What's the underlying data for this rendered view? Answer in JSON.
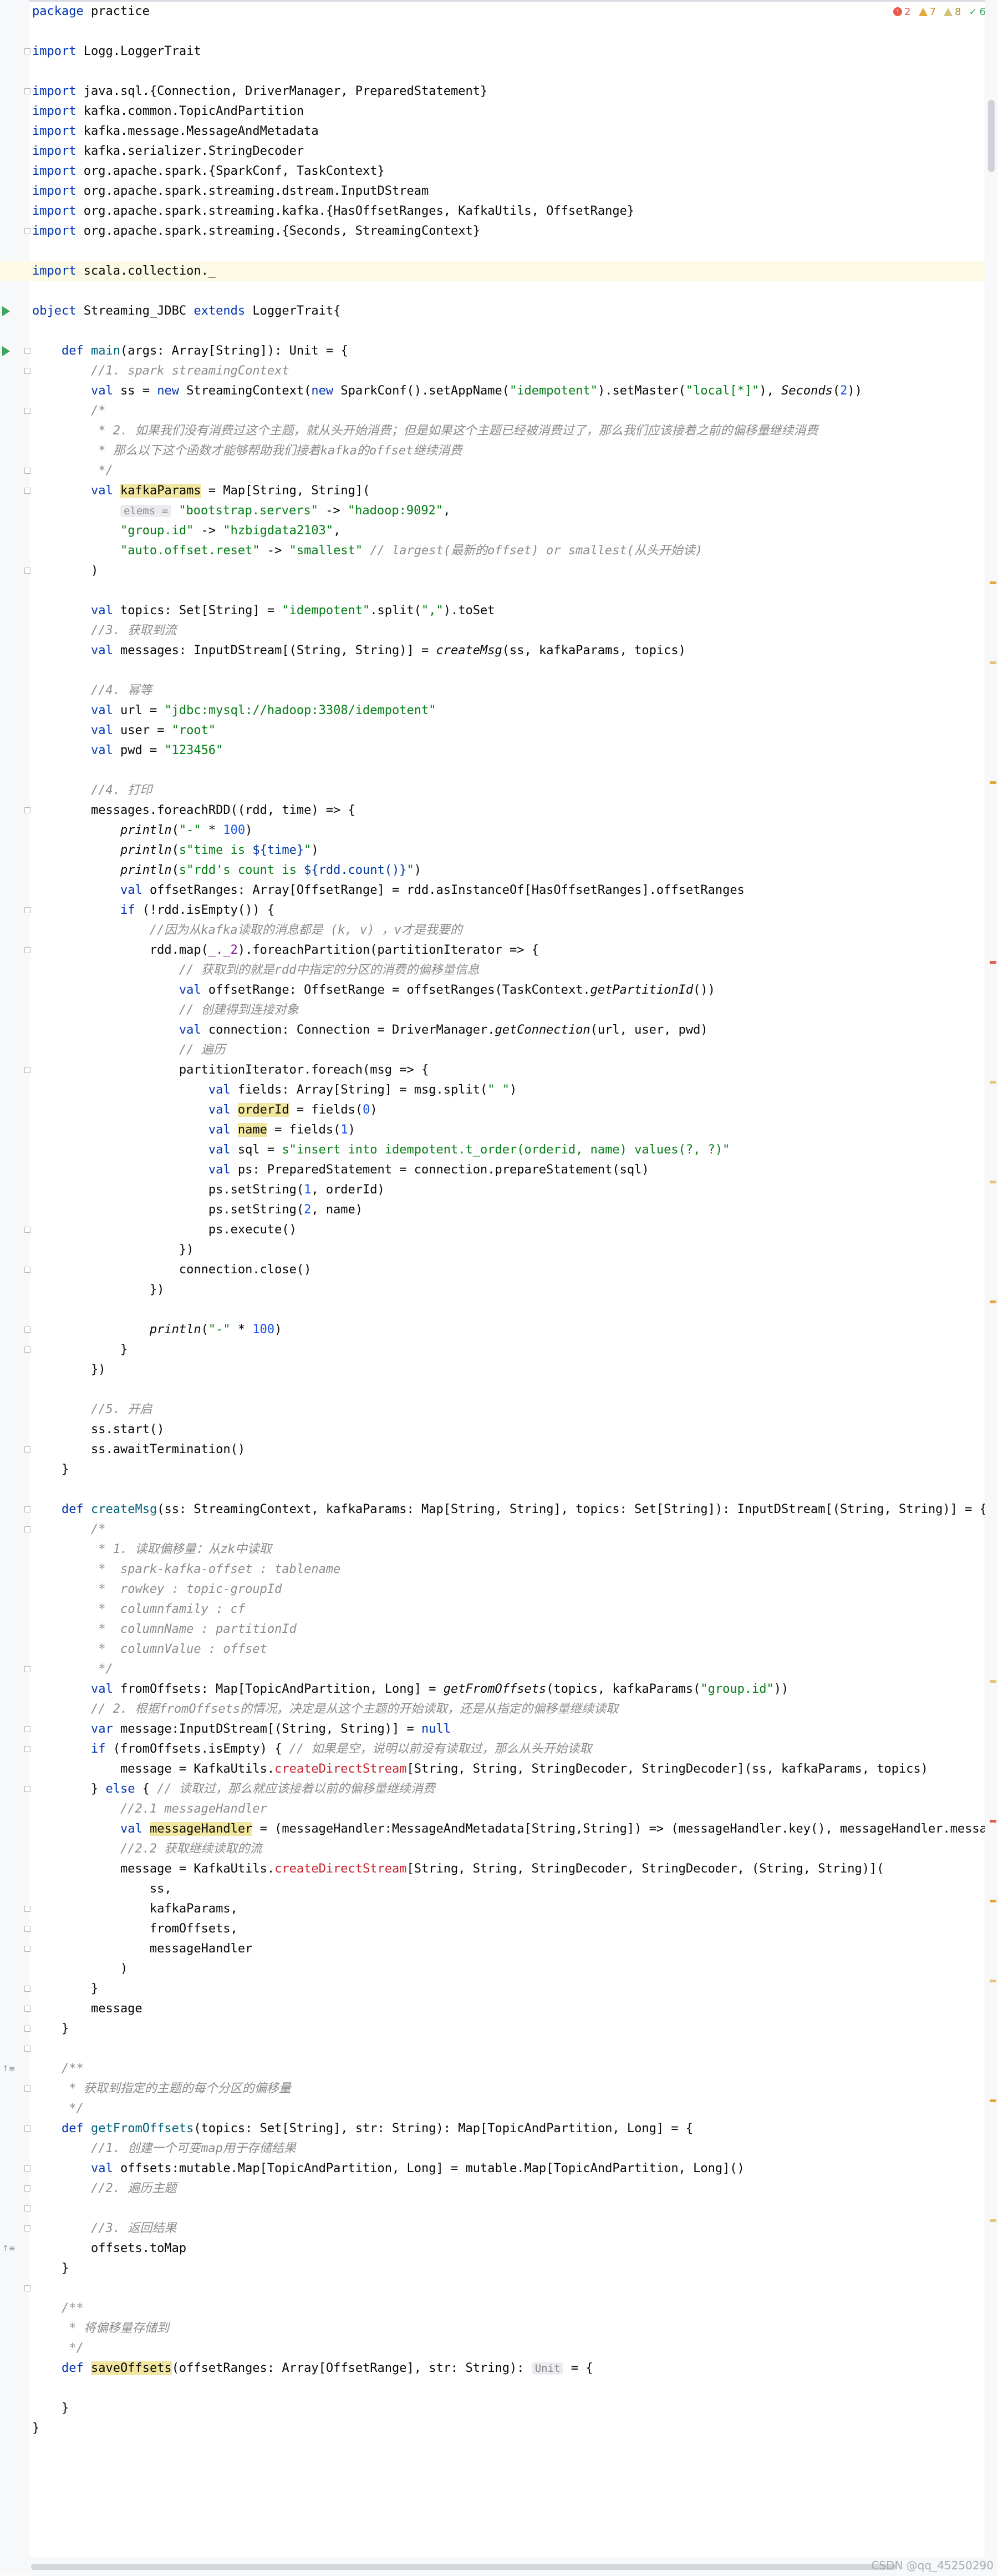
{
  "inspections": {
    "errors": "2",
    "warnings": "7",
    "weak_warnings": "8",
    "typos": "6"
  },
  "code_lines": [
    [
      {
        "t": "package",
        "k": "kw"
      },
      {
        "t": " practice"
      }
    ],
    [],
    [
      {
        "t": "import",
        "k": "kw"
      },
      {
        "t": " Logg.LoggerTrait"
      }
    ],
    [],
    [
      {
        "t": "import",
        "k": "kw"
      },
      {
        "t": " java.sql.{Connection, DriverManager, PreparedStatement}"
      }
    ],
    [
      {
        "t": "import",
        "k": "kw"
      },
      {
        "t": " kafka.common.TopicAndPartition"
      }
    ],
    [
      {
        "t": "import",
        "k": "kw"
      },
      {
        "t": " kafka.message.MessageAndMetadata"
      }
    ],
    [
      {
        "t": "import",
        "k": "kw"
      },
      {
        "t": " kafka.serializer.StringDecoder"
      }
    ],
    [
      {
        "t": "import",
        "k": "kw"
      },
      {
        "t": " org.apache.spark.{SparkConf, TaskContext}"
      }
    ],
    [
      {
        "t": "import",
        "k": "kw"
      },
      {
        "t": " org.apache.spark.streaming.dstream.InputDStream"
      }
    ],
    [
      {
        "t": "import",
        "k": "kw"
      },
      {
        "t": " org.apache.spark.streaming.kafka.{HasOffsetRanges, KafkaUtils, OffsetRange}"
      }
    ],
    [
      {
        "t": "import",
        "k": "kw"
      },
      {
        "t": " org.apache.spark.streaming.{Seconds, StreamingContext}"
      }
    ],
    [],
    [
      {
        "t": "import",
        "k": "kw"
      },
      {
        "t": " scala.collection._"
      }
    ],
    [],
    [
      {
        "t": "object",
        "k": "kw"
      },
      {
        "t": " Streaming_JDBC "
      },
      {
        "t": "extends",
        "k": "kw"
      },
      {
        "t": " LoggerTrait{"
      }
    ],
    [],
    [
      {
        "t": "    "
      },
      {
        "t": "def",
        "k": "kw"
      },
      {
        "t": " "
      },
      {
        "t": "main",
        "k": "f"
      },
      {
        "t": "(args: Array[String]): Unit = {"
      }
    ],
    [
      {
        "t": "        "
      },
      {
        "t": "//1. spark streamingContext",
        "k": "c"
      }
    ],
    [
      {
        "t": "        "
      },
      {
        "t": "val",
        "k": "kw"
      },
      {
        "t": " ss = "
      },
      {
        "t": "new",
        "k": "kw"
      },
      {
        "t": " StreamingContext("
      },
      {
        "t": "new",
        "k": "kw"
      },
      {
        "t": " SparkConf().setAppName("
      },
      {
        "t": "\"idempotent\"",
        "k": "s"
      },
      {
        "t": ").setMaster("
      },
      {
        "t": "\"local[*]\"",
        "k": "s"
      },
      {
        "t": "), "
      },
      {
        "t": "Seconds",
        "k": "it"
      },
      {
        "t": "("
      },
      {
        "t": "2",
        "k": "n"
      },
      {
        "t": "))"
      }
    ],
    [
      {
        "t": "        "
      },
      {
        "t": "/*",
        "k": "c"
      }
    ],
    [
      {
        "t": "        "
      },
      {
        "t": " * 2. 如果我们没有消费过这个主题，就从头开始消费；但是如果这个主题已经被消费过了，那么我们应该接着之前的偏移量继续消费",
        "k": "c"
      }
    ],
    [
      {
        "t": "        "
      },
      {
        "t": " * 那么以下这个函数才能够帮助我们接着kafka的offset继续消费",
        "k": "c"
      }
    ],
    [
      {
        "t": "        "
      },
      {
        "t": " */",
        "k": "c"
      }
    ],
    [
      {
        "t": "        "
      },
      {
        "t": "val",
        "k": "kw"
      },
      {
        "t": " "
      },
      {
        "t": "kafkaParams",
        "k": "hn"
      },
      {
        "t": " = Map[String, String]("
      }
    ],
    [
      {
        "t": "            "
      },
      {
        "t": "elems =",
        "k": "hint"
      },
      {
        "t": " "
      },
      {
        "t": "\"bootstrap.servers\"",
        "k": "s"
      },
      {
        "t": " -> "
      },
      {
        "t": "\"hadoop:9092\"",
        "k": "s"
      },
      {
        "t": ","
      }
    ],
    [
      {
        "t": "            "
      },
      {
        "t": "\"group.id\"",
        "k": "s"
      },
      {
        "t": " -> "
      },
      {
        "t": "\"hzbigdata2103\"",
        "k": "s"
      },
      {
        "t": ","
      }
    ],
    [
      {
        "t": "            "
      },
      {
        "t": "\"auto.offset.reset\"",
        "k": "s"
      },
      {
        "t": " -> "
      },
      {
        "t": "\"smallest\"",
        "k": "s"
      },
      {
        "t": " "
      },
      {
        "t": "// largest(最新的offset) or smallest(从头开始读)",
        "k": "c"
      }
    ],
    [
      {
        "t": "        )"
      }
    ],
    [],
    [
      {
        "t": "        "
      },
      {
        "t": "val",
        "k": "kw"
      },
      {
        "t": " topics: Set[String] = "
      },
      {
        "t": "\"idempotent\"",
        "k": "s"
      },
      {
        "t": ".split("
      },
      {
        "t": "\",\"",
        "k": "s"
      },
      {
        "t": ").toSet"
      }
    ],
    [
      {
        "t": "        "
      },
      {
        "t": "//3. 获取到流",
        "k": "c"
      }
    ],
    [
      {
        "t": "        "
      },
      {
        "t": "val",
        "k": "kw"
      },
      {
        "t": " messages: InputDStream[(String, String)] = "
      },
      {
        "t": "createMsg",
        "k": "it"
      },
      {
        "t": "(ss, kafkaParams, topics)"
      }
    ],
    [],
    [
      {
        "t": "        "
      },
      {
        "t": "//4. 幂等",
        "k": "c"
      }
    ],
    [
      {
        "t": "        "
      },
      {
        "t": "val",
        "k": "kw"
      },
      {
        "t": " url = "
      },
      {
        "t": "\"jdbc:mysql://hadoop:3308/idempotent\"",
        "k": "s"
      }
    ],
    [
      {
        "t": "        "
      },
      {
        "t": "val",
        "k": "kw"
      },
      {
        "t": " user = "
      },
      {
        "t": "\"root\"",
        "k": "s"
      }
    ],
    [
      {
        "t": "        "
      },
      {
        "t": "val",
        "k": "kw"
      },
      {
        "t": " pwd = "
      },
      {
        "t": "\"123456\"",
        "k": "s"
      }
    ],
    [],
    [
      {
        "t": "        "
      },
      {
        "t": "//4. 打印",
        "k": "c"
      }
    ],
    [
      {
        "t": "        messages.foreachRDD((rdd, time) => {"
      }
    ],
    [
      {
        "t": "            "
      },
      {
        "t": "println",
        "k": "it"
      },
      {
        "t": "("
      },
      {
        "t": "\"-\"",
        "k": "s"
      },
      {
        "t": " * "
      },
      {
        "t": "100",
        "k": "n"
      },
      {
        "t": ")"
      }
    ],
    [
      {
        "t": "            "
      },
      {
        "t": "println",
        "k": "it"
      },
      {
        "t": "("
      },
      {
        "t": "s\"time is ",
        "k": "s"
      },
      {
        "t": "${time}",
        "k": "tpl"
      },
      {
        "t": "\"",
        "k": "s"
      },
      {
        "t": ")"
      }
    ],
    [
      {
        "t": "            "
      },
      {
        "t": "println",
        "k": "it"
      },
      {
        "t": "("
      },
      {
        "t": "s\"rdd's count is ",
        "k": "s"
      },
      {
        "t": "${rdd.count()}",
        "k": "tpl"
      },
      {
        "t": "\"",
        "k": "s"
      },
      {
        "t": ")"
      }
    ],
    [
      {
        "t": "            "
      },
      {
        "t": "val",
        "k": "kw"
      },
      {
        "t": " offsetRanges: Array[OffsetRange] = rdd.asInstanceOf[HasOffsetRanges].offsetRanges"
      }
    ],
    [
      {
        "t": "            "
      },
      {
        "t": "if",
        "k": "kw"
      },
      {
        "t": " (!rdd.isEmpty()) {"
      }
    ],
    [
      {
        "t": "                "
      },
      {
        "t": "//因为从kafka读取的消息都是 (k, v) ，v才是我要的",
        "k": "c"
      }
    ],
    [
      {
        "t": "                rdd.map("
      },
      {
        "t": "_._2",
        "k": "p"
      },
      {
        "t": ").foreachPartition(partitionIterator => {"
      }
    ],
    [
      {
        "t": "                    "
      },
      {
        "t": "// 获取到的就是rdd中指定的分区的消费的偏移量信息",
        "k": "c"
      }
    ],
    [
      {
        "t": "                    "
      },
      {
        "t": "val",
        "k": "kw"
      },
      {
        "t": " offsetRange: OffsetRange = offsetRanges(TaskContext."
      },
      {
        "t": "getPartitionId",
        "k": "it"
      },
      {
        "t": "())"
      }
    ],
    [
      {
        "t": "                    "
      },
      {
        "t": "// 创建得到连接对象",
        "k": "c"
      }
    ],
    [
      {
        "t": "                    "
      },
      {
        "t": "val",
        "k": "kw"
      },
      {
        "t": " connection: Connection = DriverManager."
      },
      {
        "t": "getConnection",
        "k": "it"
      },
      {
        "t": "(url, user, pwd)"
      }
    ],
    [
      {
        "t": "                    "
      },
      {
        "t": "// 遍历",
        "k": "c"
      }
    ],
    [
      {
        "t": "                    partitionIterator.foreach(msg => {"
      }
    ],
    [
      {
        "t": "                        "
      },
      {
        "t": "val",
        "k": "kw"
      },
      {
        "t": " fields: Array[String] = msg.split("
      },
      {
        "t": "\" \"",
        "k": "s"
      },
      {
        "t": ")"
      }
    ],
    [
      {
        "t": "                        "
      },
      {
        "t": "val",
        "k": "kw"
      },
      {
        "t": " "
      },
      {
        "t": "orderId",
        "k": "hn"
      },
      {
        "t": " = fields("
      },
      {
        "t": "0",
        "k": "n"
      },
      {
        "t": ")"
      }
    ],
    [
      {
        "t": "                        "
      },
      {
        "t": "val",
        "k": "kw"
      },
      {
        "t": " "
      },
      {
        "t": "name",
        "k": "hn"
      },
      {
        "t": " = fields("
      },
      {
        "t": "1",
        "k": "n"
      },
      {
        "t": ")"
      }
    ],
    [
      {
        "t": "                        "
      },
      {
        "t": "val",
        "k": "kw"
      },
      {
        "t": " sql = "
      },
      {
        "t": "s\"insert into idempotent.t_order(orderid, name) values(?, ?)\"",
        "k": "s"
      }
    ],
    [
      {
        "t": "                        "
      },
      {
        "t": "val",
        "k": "kw"
      },
      {
        "t": " ps: PreparedStatement = connection.prepareStatement(sql)"
      }
    ],
    [
      {
        "t": "                        ps.setString("
      },
      {
        "t": "1",
        "k": "n"
      },
      {
        "t": ", orderId)"
      }
    ],
    [
      {
        "t": "                        ps.setString("
      },
      {
        "t": "2",
        "k": "n"
      },
      {
        "t": ", name)"
      }
    ],
    [
      {
        "t": "                        ps.execute()"
      }
    ],
    [
      {
        "t": "                    })"
      }
    ],
    [
      {
        "t": "                    connection.close()"
      }
    ],
    [
      {
        "t": "                })"
      }
    ],
    [],
    [
      {
        "t": "                "
      },
      {
        "t": "println",
        "k": "it"
      },
      {
        "t": "("
      },
      {
        "t": "\"-\"",
        "k": "s"
      },
      {
        "t": " * "
      },
      {
        "t": "100",
        "k": "n"
      },
      {
        "t": ")"
      }
    ],
    [
      {
        "t": "            }"
      }
    ],
    [
      {
        "t": "        })"
      }
    ],
    [],
    [
      {
        "t": "        "
      },
      {
        "t": "//5. 开启",
        "k": "c"
      }
    ],
    [
      {
        "t": "        ss.start()"
      }
    ],
    [
      {
        "t": "        ss.awaitTermination()"
      }
    ],
    [
      {
        "t": "    }"
      }
    ],
    [],
    [
      {
        "t": "    "
      },
      {
        "t": "def",
        "k": "kw"
      },
      {
        "t": " "
      },
      {
        "t": "createMsg",
        "k": "f"
      },
      {
        "t": "(ss: StreamingContext, kafkaParams: Map[String, String], topics: Set[String]): InputDStream[(String, String)] = {"
      }
    ],
    [
      {
        "t": "        "
      },
      {
        "t": "/*",
        "k": "c"
      }
    ],
    [
      {
        "t": "        "
      },
      {
        "t": " * 1. 读取偏移量：从zk中读取",
        "k": "c"
      }
    ],
    [
      {
        "t": "        "
      },
      {
        "t": " *  spark-kafka-offset : tablename",
        "k": "c"
      }
    ],
    [
      {
        "t": "        "
      },
      {
        "t": " *  rowkey : topic-groupId",
        "k": "c"
      }
    ],
    [
      {
        "t": "        "
      },
      {
        "t": " *  columnfamily : cf",
        "k": "c"
      }
    ],
    [
      {
        "t": "        "
      },
      {
        "t": " *  columnName : partitionId",
        "k": "c"
      }
    ],
    [
      {
        "t": "        "
      },
      {
        "t": " *  columnValue : offset",
        "k": "c"
      }
    ],
    [
      {
        "t": "        "
      },
      {
        "t": " */",
        "k": "c"
      }
    ],
    [
      {
        "t": "        "
      },
      {
        "t": "val",
        "k": "kw"
      },
      {
        "t": " fromOffsets: Map[TopicAndPartition, Long] = "
      },
      {
        "t": "getFromOffsets",
        "k": "it"
      },
      {
        "t": "(topics, kafkaParams("
      },
      {
        "t": "\"group.id\"",
        "k": "s"
      },
      {
        "t": "))"
      }
    ],
    [
      {
        "t": "        "
      },
      {
        "t": "// 2. 根据fromOffsets的情况，决定是从这个主题的开始读取，还是从指定的偏移量继续读取",
        "k": "c"
      }
    ],
    [
      {
        "t": "        "
      },
      {
        "t": "var",
        "k": "kw"
      },
      {
        "t": " message:InputDStream[(String, String)] = "
      },
      {
        "t": "null",
        "k": "kw"
      }
    ],
    [
      {
        "t": "        "
      },
      {
        "t": "if",
        "k": "kw"
      },
      {
        "t": " (fromOffsets.isEmpty) { "
      },
      {
        "t": "// 如果是空，说明以前没有读取过，那么从头开始读取",
        "k": "c"
      }
    ],
    [
      {
        "t": "            message = KafkaUtils."
      },
      {
        "t": "createDirectStream",
        "k": "r"
      },
      {
        "t": "[String, String, StringDecoder, StringDecoder](ss, kafkaParams, topics)"
      }
    ],
    [
      {
        "t": "        } "
      },
      {
        "t": "else",
        "k": "kw"
      },
      {
        "t": " { "
      },
      {
        "t": "// 读取过，那么就应该接着以前的偏移量继续消费",
        "k": "c"
      }
    ],
    [
      {
        "t": "            "
      },
      {
        "t": "//2.1 messageHandler",
        "k": "c"
      }
    ],
    [
      {
        "t": "            "
      },
      {
        "t": "val",
        "k": "kw"
      },
      {
        "t": " "
      },
      {
        "t": "messageHandler",
        "k": "hn"
      },
      {
        "t": " = (messageHandler:MessageAndMetadata[String,String]) => (messageHandler.key(), messageHandler.message())"
      }
    ],
    [
      {
        "t": "            "
      },
      {
        "t": "//2.2 获取继续读取的流",
        "k": "c"
      }
    ],
    [
      {
        "t": "            message = KafkaUtils."
      },
      {
        "t": "createDirectStream",
        "k": "r"
      },
      {
        "t": "[String, String, StringDecoder, StringDecoder, (String, String)]("
      }
    ],
    [
      {
        "t": "                ss,"
      }
    ],
    [
      {
        "t": "                kafkaParams,"
      }
    ],
    [
      {
        "t": "                fromOffsets,"
      }
    ],
    [
      {
        "t": "                messageHandler"
      }
    ],
    [
      {
        "t": "            )"
      }
    ],
    [
      {
        "t": "        }"
      }
    ],
    [
      {
        "t": "        message"
      }
    ],
    [
      {
        "t": "    }"
      }
    ],
    [],
    [
      {
        "t": "    "
      },
      {
        "t": "/**",
        "k": "c"
      }
    ],
    [
      {
        "t": "    "
      },
      {
        "t": " * 获取到指定的主题的每个分区的偏移量",
        "k": "c"
      }
    ],
    [
      {
        "t": "    "
      },
      {
        "t": " */",
        "k": "c"
      }
    ],
    [
      {
        "t": "    "
      },
      {
        "t": "def",
        "k": "kw"
      },
      {
        "t": " "
      },
      {
        "t": "getFromOffsets",
        "k": "f"
      },
      {
        "t": "(topics: Set[String], str: String): Map[TopicAndPartition, Long] = {"
      }
    ],
    [
      {
        "t": "        "
      },
      {
        "t": "//1. 创建一个可变map用于存储结果",
        "k": "c"
      }
    ],
    [
      {
        "t": "        "
      },
      {
        "t": "val",
        "k": "kw"
      },
      {
        "t": " offsets:mutable.Map[TopicAndPartition, Long] = mutable.Map[TopicAndPartition, Long]()"
      }
    ],
    [
      {
        "t": "        "
      },
      {
        "t": "//2. 遍历主题",
        "k": "c"
      }
    ],
    [],
    [
      {
        "t": "        "
      },
      {
        "t": "//3. 返回结果",
        "k": "c"
      }
    ],
    [
      {
        "t": "        offsets.toMap"
      }
    ],
    [
      {
        "t": "    }"
      }
    ],
    [],
    [
      {
        "t": "    "
      },
      {
        "t": "/**",
        "k": "c"
      }
    ],
    [
      {
        "t": "    "
      },
      {
        "t": " * 将偏移量存储到",
        "k": "c"
      }
    ],
    [
      {
        "t": "    "
      },
      {
        "t": " */",
        "k": "c"
      }
    ],
    [
      {
        "t": "    "
      },
      {
        "t": "def",
        "k": "kw"
      },
      {
        "t": " "
      },
      {
        "t": "saveOffsets",
        "k": "hn"
      },
      {
        "t": "(offsetRanges: Array[OffsetRange], str: String): "
      },
      {
        "t": "Unit",
        "k": "hint"
      },
      {
        "t": " = {"
      }
    ],
    [],
    [
      {
        "t": "    }"
      }
    ],
    [
      {
        "t": "}"
      }
    ]
  ],
  "watermark": "CSDN @qq_45250290"
}
